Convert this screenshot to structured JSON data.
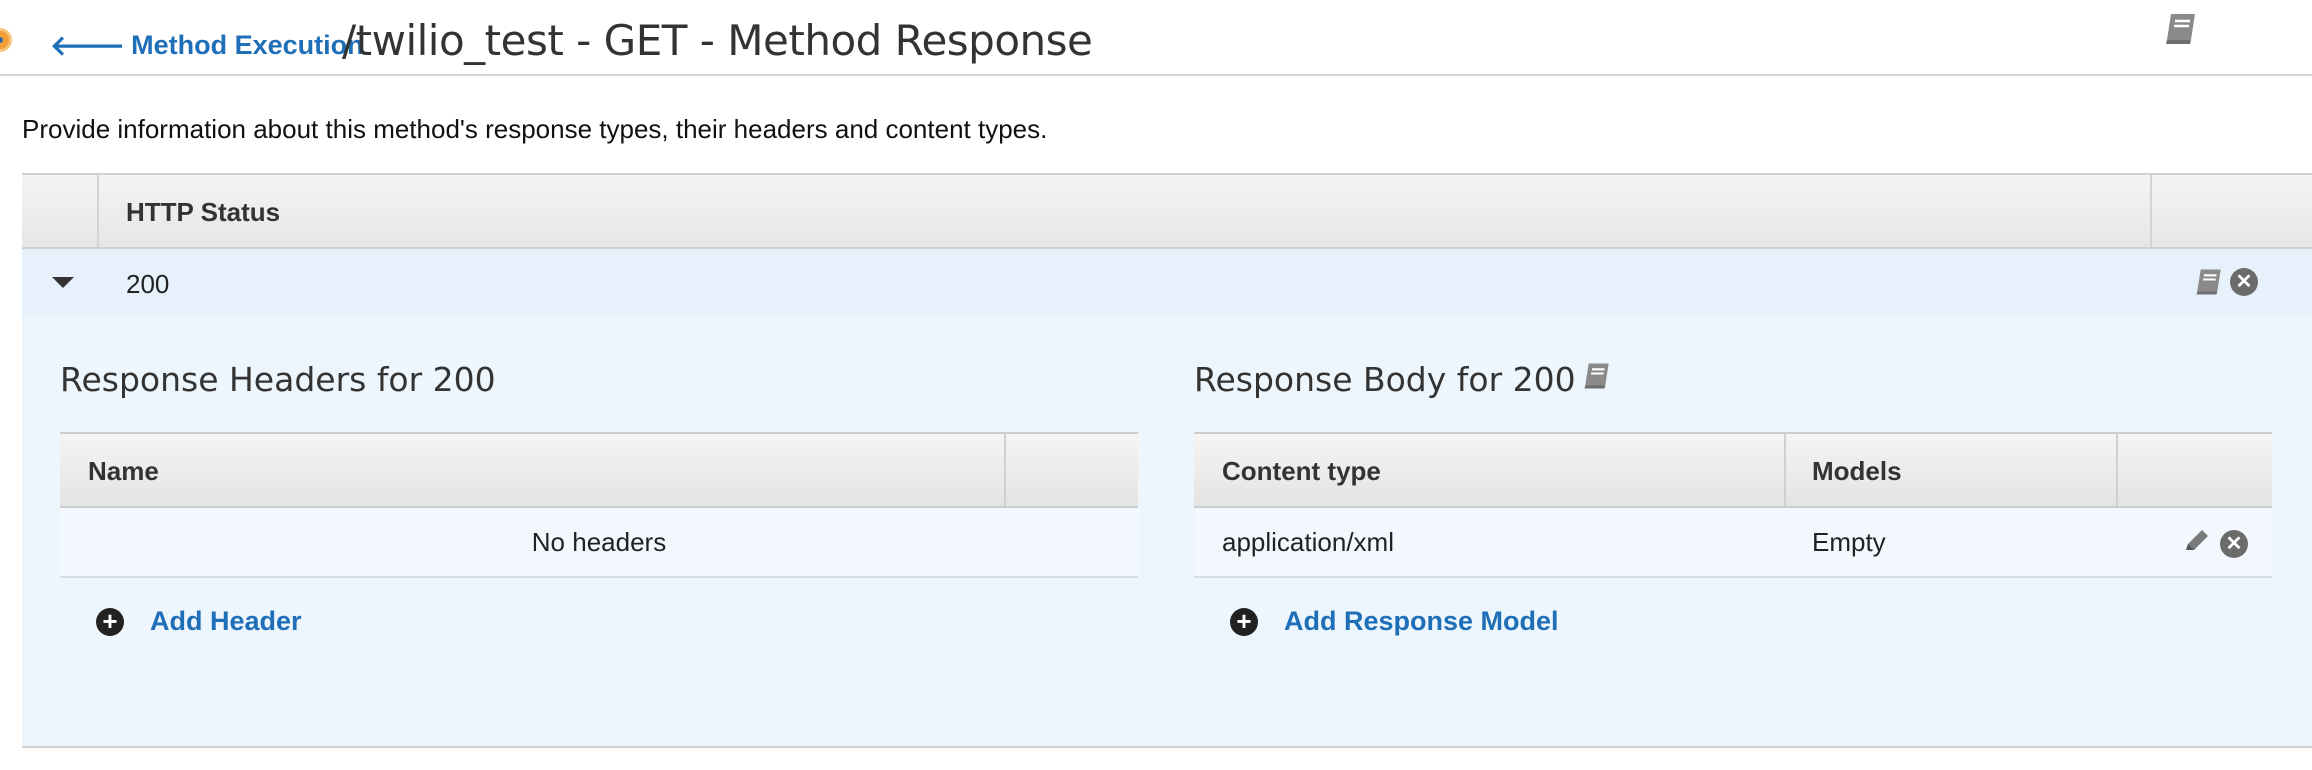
{
  "header": {
    "back_link": "Method Execution",
    "title": "/twilio_test - GET - Method Response"
  },
  "description": "Provide information about this method's response types, their headers and content types.",
  "status_table": {
    "column_header": "HTTP Status",
    "rows": [
      {
        "status": "200"
      }
    ]
  },
  "response_headers": {
    "title": "Response Headers for 200",
    "columns": [
      "Name"
    ],
    "empty_text": "No headers",
    "add_label": "Add Header"
  },
  "response_body": {
    "title": "Response Body for 200",
    "columns": [
      "Content type",
      "Models"
    ],
    "rows": [
      {
        "content_type": "application/xml",
        "model": "Empty"
      }
    ],
    "add_label": "Add Response Model"
  },
  "icons": {
    "back": "arrow-left-icon",
    "docs": "book-icon",
    "delete": "close-circle-icon",
    "edit": "pencil-icon",
    "add": "plus-circle-icon",
    "expand": "caret-down-icon"
  },
  "colors": {
    "link": "#1f6fb8",
    "accent": "#f29f38",
    "panel_bg": "#edf5fd"
  }
}
